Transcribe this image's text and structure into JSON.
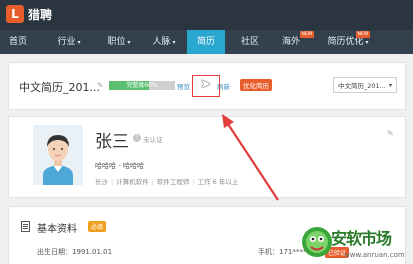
{
  "app": {
    "logo_mark": "L",
    "logo_text": "猎聘"
  },
  "nav": {
    "items": [
      {
        "label": "首页",
        "caret": ""
      },
      {
        "label": "行业",
        "caret": "▾"
      },
      {
        "label": "职位",
        "caret": "▾"
      },
      {
        "label": "人脉",
        "caret": "▾"
      },
      {
        "label": "简历",
        "caret": ""
      },
      {
        "label": "社区",
        "caret": ""
      },
      {
        "label": "海外",
        "caret": ""
      },
      {
        "label": "简历优化",
        "caret": "▾"
      }
    ],
    "active_index": 4,
    "new_badge": "NEW"
  },
  "resume": {
    "title": "中文简历_201...",
    "completeness_label": "完整度",
    "completeness_value": "60%",
    "completeness_fraction": 0.6,
    "links": [
      "预览",
      "刷新"
    ],
    "optimize_label": "优化简历",
    "lang_select": "中文简历_201...",
    "select_caret": "▾"
  },
  "profile": {
    "name": "张三",
    "verify_icon": "!",
    "verify_status": "未认证",
    "headline": "哈哈哈 - 哈哈哈",
    "tags": [
      "长沙",
      "计算机软件",
      "软件工程师",
      "工作 6 年以上"
    ]
  },
  "basic": {
    "title": "基本资料",
    "required_badge": "必填",
    "birth_label": "出生日期：",
    "birth_value": "1991.01.01",
    "phone_label": "手机：",
    "phone_value": "171****",
    "verified_label": "已验证"
  },
  "watermark": {
    "text": "安软市场",
    "url": "www.anruan.com"
  },
  "colors": {
    "topbar": "#2a3540",
    "navbar": "#33414f",
    "active_tab": "#2aa7ce",
    "accent": "#e85d2c",
    "progress": "#5bbf6f",
    "highlight": "#e23b3b"
  }
}
